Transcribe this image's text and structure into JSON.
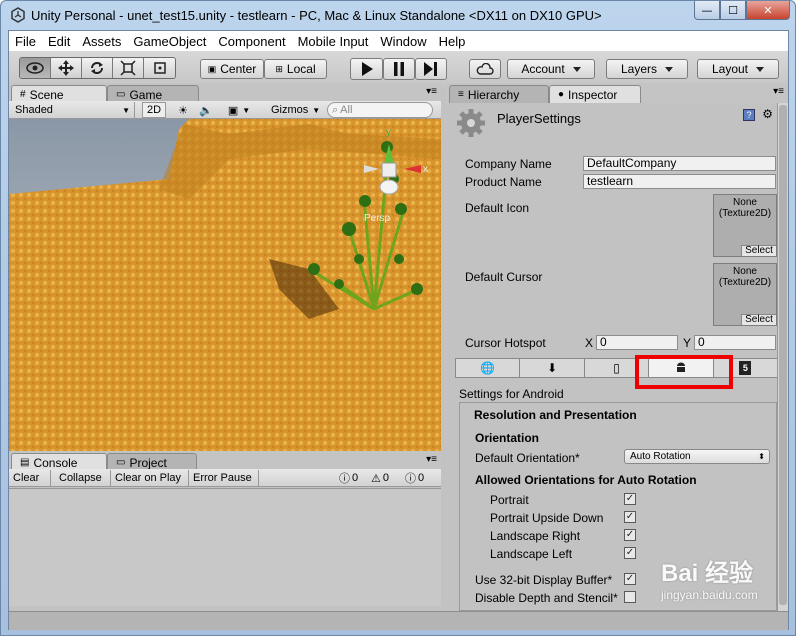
{
  "window": {
    "title": "Unity Personal - unet_test15.unity - testlearn - PC, Mac & Linux Standalone <DX11 on DX10 GPU>",
    "min": "—",
    "max": "☐",
    "close": "✕"
  },
  "menu": [
    "File",
    "Edit",
    "Assets",
    "GameObject",
    "Component",
    "Mobile Input",
    "Window",
    "Help"
  ],
  "toolbar": {
    "center": "Center",
    "local": "Local",
    "account": "Account",
    "layers": "Layers",
    "layout": "Layout"
  },
  "scene": {
    "tab_scene": "Scene",
    "tab_game": "Game",
    "shading": "Shaded",
    "mode_2d": "2D",
    "gizmos": "Gizmos",
    "search_placeholder": "All",
    "persp": "Persp",
    "gizmo_x": "x",
    "gizmo_y": "y"
  },
  "console": {
    "tab_console": "Console",
    "tab_project": "Project",
    "clear": "Clear",
    "collapse": "Collapse",
    "clear_on_play": "Clear on Play",
    "error_pause": "Error Pause",
    "count_info": "0",
    "count_warn": "0",
    "count_err": "0"
  },
  "inspector": {
    "tab_hierarchy": "Hierarchy",
    "tab_inspector": "Inspector",
    "title": "PlayerSettings",
    "company_label": "Company Name",
    "company_value": "DefaultCompany",
    "product_label": "Product Name",
    "product_value": "testlearn",
    "default_icon": "Default Icon",
    "default_cursor": "Default Cursor",
    "tex_none": "None",
    "tex_type": "(Texture2D)",
    "select": "Select",
    "hotspot_label": "Cursor Hotspot",
    "hotspot_x_label": "X",
    "hotspot_x": "0",
    "hotspot_y_label": "Y",
    "hotspot_y": "0",
    "settings_for": "Settings for Android",
    "section": "Resolution and Presentation",
    "orientation": "Orientation",
    "default_orientation_label": "Default Orientation*",
    "default_orientation_value": "Auto Rotation",
    "allowed": "Allowed Orientations for Auto Rotation",
    "portrait": "Portrait",
    "portrait_down": "Portrait Upside Down",
    "landscape_right": "Landscape Right",
    "landscape_left": "Landscape Left",
    "use32": "Use 32-bit Display Buffer*",
    "disable_depth": "Disable Depth and Stencil*",
    "check": "✓"
  },
  "watermark": {
    "text": "Bai 经验",
    "url": "jingyan.baidu.com"
  },
  "colors": {
    "highlight": "#ee0000",
    "terrain": "#d9962e"
  }
}
